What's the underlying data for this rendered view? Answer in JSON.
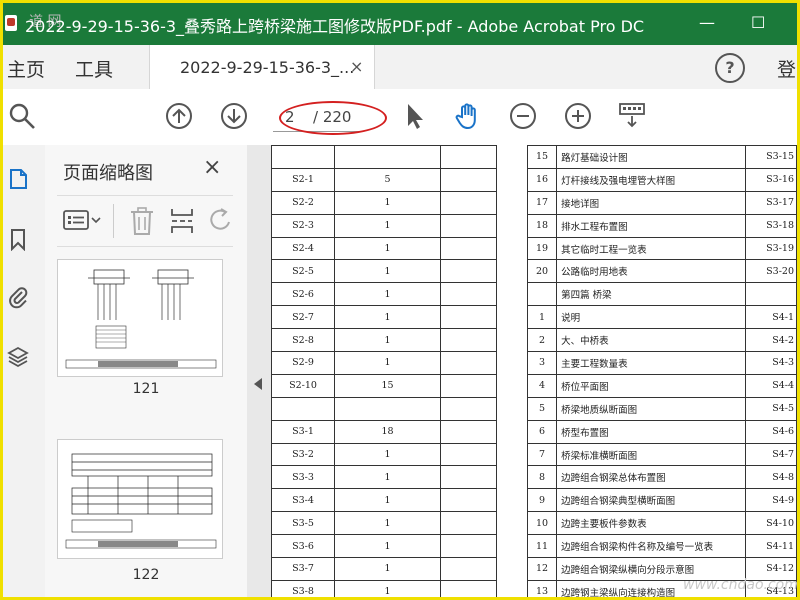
{
  "window": {
    "title": "2022-9-29-15-36-3_叠秀路上跨桥梁施工图修改版PDF.pdf - Adobe Acrobat Pro DC",
    "minimize": "—",
    "maximize": "☐"
  },
  "tabs": {
    "home": "主页",
    "tools": "工具",
    "document": "2022-9-29-15-36-3_...",
    "close": "×",
    "help": "?",
    "login": "登"
  },
  "toolbar": {
    "current_page": "2",
    "total_pages": "/ 220"
  },
  "thumbnails": {
    "title": "页面缩略图",
    "close": "×",
    "pages": [
      {
        "label": "121"
      },
      {
        "label": "122"
      }
    ]
  },
  "accent_colors": {
    "titlebar": "#1b7a3a",
    "annotation": "#d42020",
    "frame": "#f0e000"
  },
  "icons": [
    "search-icon",
    "previous-page-icon",
    "next-page-icon",
    "select-pointer-icon",
    "hand-tool-icon",
    "zoom-out-icon",
    "zoom-in-icon",
    "keyboard-icon",
    "page-thumbnails-icon",
    "bookmark-icon",
    "attachment-icon",
    "layers-icon",
    "options-menu-icon",
    "delete-icon",
    "insert-page-icon",
    "rotate-icon"
  ],
  "doc_table": {
    "left_rows": [
      {
        "code": "",
        "count": "",
        "extra": ""
      },
      {
        "code": "S2-1",
        "count": "5",
        "extra": ""
      },
      {
        "code": "S2-2",
        "count": "1",
        "extra": ""
      },
      {
        "code": "S2-3",
        "count": "1",
        "extra": ""
      },
      {
        "code": "S2-4",
        "count": "1",
        "extra": ""
      },
      {
        "code": "S2-5",
        "count": "1",
        "extra": ""
      },
      {
        "code": "S2-6",
        "count": "1",
        "extra": ""
      },
      {
        "code": "S2-7",
        "count": "1",
        "extra": ""
      },
      {
        "code": "S2-8",
        "count": "1",
        "extra": ""
      },
      {
        "code": "S2-9",
        "count": "1",
        "extra": ""
      },
      {
        "code": "S2-10",
        "count": "15",
        "extra": ""
      },
      {
        "code": "",
        "count": "",
        "extra": ""
      },
      {
        "code": "S3-1",
        "count": "18",
        "extra": ""
      },
      {
        "code": "S3-2",
        "count": "1",
        "extra": ""
      },
      {
        "code": "S3-3",
        "count": "1",
        "extra": ""
      },
      {
        "code": "S3-4",
        "count": "1",
        "extra": ""
      },
      {
        "code": "S3-5",
        "count": "1",
        "extra": ""
      },
      {
        "code": "S3-6",
        "count": "1",
        "extra": ""
      },
      {
        "code": "S3-7",
        "count": "1",
        "extra": ""
      },
      {
        "code": "S3-8",
        "count": "1",
        "extra": ""
      }
    ],
    "right_rows": [
      {
        "no": "15",
        "name": "路灯基础设计图",
        "code": "S3-15"
      },
      {
        "no": "16",
        "name": "灯杆接线及强电埋管大样图",
        "code": "S3-16"
      },
      {
        "no": "17",
        "name": "接地详图",
        "code": "S3-17"
      },
      {
        "no": "18",
        "name": "排水工程布置图",
        "code": "S3-18"
      },
      {
        "no": "19",
        "name": "其它临时工程一览表",
        "code": "S3-19"
      },
      {
        "no": "20",
        "name": "公路临时用地表",
        "code": "S3-20"
      },
      {
        "no": "",
        "name": "第四篇  桥梁",
        "code": ""
      },
      {
        "no": "1",
        "name": "说明",
        "code": "S4-1"
      },
      {
        "no": "2",
        "name": "大、中桥表",
        "code": "S4-2"
      },
      {
        "no": "3",
        "name": "主要工程数量表",
        "code": "S4-3"
      },
      {
        "no": "4",
        "name": "桥位平面图",
        "code": "S4-4"
      },
      {
        "no": "5",
        "name": "桥梁地质纵断面图",
        "code": "S4-5"
      },
      {
        "no": "6",
        "name": "桥型布置图",
        "code": "S4-6"
      },
      {
        "no": "7",
        "name": "桥梁标准横断面图",
        "code": "S4-7"
      },
      {
        "no": "8",
        "name": "边跨组合钢梁总体布置图",
        "code": "S4-8"
      },
      {
        "no": "9",
        "name": "边跨组合钢梁典型横断面图",
        "code": "S4-9"
      },
      {
        "no": "10",
        "name": "边跨主要板件参数表",
        "code": "S4-10"
      },
      {
        "no": "11",
        "name": "边跨组合钢梁构件名称及编号一览表",
        "code": "S4-11"
      },
      {
        "no": "12",
        "name": "边跨组合钢梁纵横向分段示意图",
        "code": "S4-12"
      },
      {
        "no": "13",
        "name": "边跨钢主梁纵向连接构造图",
        "code": "S4-13"
      }
    ]
  },
  "watermark": {
    "bottom": "www.cndao.com",
    "top": "道 网"
  }
}
